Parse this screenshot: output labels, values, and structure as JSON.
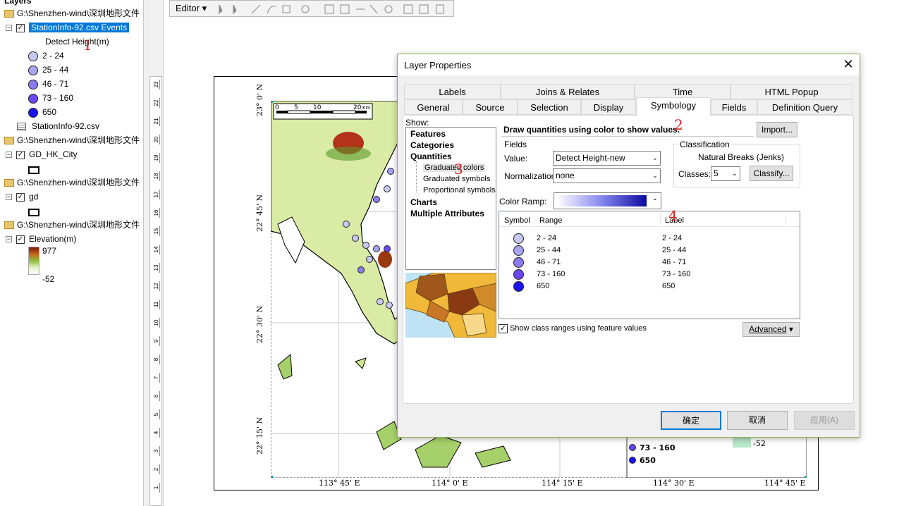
{
  "toc": {
    "header": "Layers",
    "folder1": "G:\\Shenzhen-wind\\深圳地形文件",
    "station_layer": "StationInfo-92.csv Events",
    "field_name": "Detect Height(m)",
    "classes": [
      "2 - 24",
      "25 - 44",
      "46 - 71",
      "73 - 160",
      "650"
    ],
    "table_name": "StationInfo-92.csv",
    "folder2": "G:\\Shenzhen-wind\\深圳地形文件",
    "city_layer": "GD_HK_City",
    "folder3": "G:\\Shenzhen-wind\\深圳地形文件",
    "gd_layer": "gd",
    "folder4": "G:\\Shenzhen-wind\\深圳地形文件",
    "elev_layer": "Elevation(m)",
    "elev_high": "977",
    "elev_low": "-52"
  },
  "toolbar": {
    "editor_label": "Editor"
  },
  "colors": {
    "classes": [
      "#c9c9f7",
      "#a8a4f0",
      "#8b7df0",
      "#6b47f0",
      "#1a12f0"
    ],
    "accent": "#0078d7",
    "annotation": "#e02020"
  },
  "ruler": {
    "ticks": [
      "23",
      "22",
      "21",
      "20",
      "19",
      "18",
      "17",
      "16",
      "15",
      "14",
      "13",
      "12",
      "11",
      "10",
      "9",
      "8",
      "7",
      "6",
      "5",
      "4",
      "3",
      "2",
      "1"
    ]
  },
  "map": {
    "lat_labels": [
      "23° 0' N",
      "22° 45' N",
      "22° 30' N",
      "22° 15' N"
    ],
    "lon_labels": [
      "113° 45' E",
      "114° 0' E",
      "114° 15' E",
      "114° 30' E",
      "114° 45' E"
    ],
    "scalebar": [
      "0",
      "5",
      "10",
      "20",
      "Km"
    ],
    "legend_items": [
      "73  -  160",
      "650"
    ],
    "legend_elev_low": "-52"
  },
  "dialog": {
    "title": "Layer Properties",
    "tabs_row1": [
      "Labels",
      "Joins & Relates",
      "Time",
      "HTML Popup"
    ],
    "tabs_row2": [
      "General",
      "Source",
      "Selection",
      "Display",
      "Symbology",
      "Fields",
      "Definition Query"
    ],
    "show_label": "Show:",
    "show_tree": {
      "features": "Features",
      "categories": "Categories",
      "quantities": "Quantities",
      "sub": [
        "Graduated colors",
        "Graduated symbols",
        "Proportional symbols"
      ],
      "charts": "Charts",
      "multiple": "Multiple Attributes"
    },
    "heading": "Draw quantities using color to show values.",
    "import_btn": "Import...",
    "fields_group": "Fields",
    "value_label": "Value:",
    "value_selected": "Detect Height-new",
    "normalization_label": "Normalization:",
    "normalization_selected": "none",
    "classification_group": "Classification",
    "method": "Natural Breaks (Jenks)",
    "classes_label": "Classes:",
    "classes_selected": "5",
    "classify_btn": "Classify...",
    "color_ramp_label": "Color Ramp:",
    "col_symbol": "Symbol",
    "col_range": "Range",
    "col_label": "Label",
    "rows": [
      {
        "range": "2 - 24",
        "label": "2 - 24"
      },
      {
        "range": "25 - 44",
        "label": "25 - 44"
      },
      {
        "range": "46 - 71",
        "label": "46 - 71"
      },
      {
        "range": "73 - 160",
        "label": "73 - 160"
      },
      {
        "range": "650",
        "label": "650"
      }
    ],
    "show_ranges_label": "Show class ranges using feature values",
    "advanced_btn": "Advanced",
    "ok_btn": "确定",
    "cancel_btn": "取消",
    "apply_btn": "应用(A)"
  },
  "annotations": [
    "1",
    "2",
    "3",
    "4"
  ]
}
